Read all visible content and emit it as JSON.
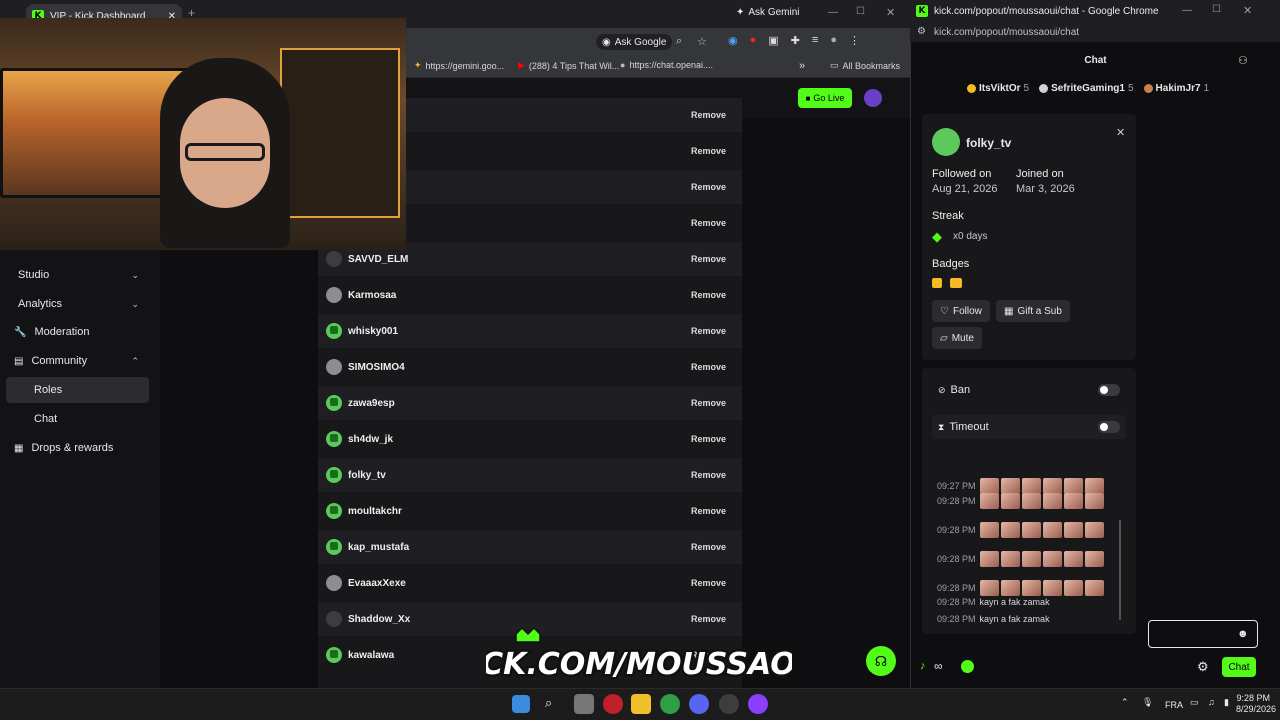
{
  "left_window": {
    "tab_title": "VIP - Kick Dashboard",
    "gemini_label": "Ask Gemini",
    "ask_google": "Ask Google",
    "bookmarks": [
      {
        "label": "https://gemini.goo..."
      },
      {
        "label": "(288) 4 Tips That Wil..."
      },
      {
        "label": "https://chat.openai...."
      }
    ],
    "all_bookmarks": "All Bookmarks"
  },
  "dashboard": {
    "go_live": "Go Live",
    "sidebar": [
      {
        "label": "Studio",
        "icon": "chevron-down-icon"
      },
      {
        "label": "Analytics",
        "icon": "chevron-down-icon"
      },
      {
        "label": "Moderation",
        "icon": "wrench-icon"
      },
      {
        "label": "Community",
        "icon": "chevron-up-icon"
      },
      {
        "label": "Roles",
        "active": true
      },
      {
        "label": "Chat"
      },
      {
        "label": "Drops & rewards",
        "icon": "gift-icon"
      }
    ],
    "remove_label": "Remove",
    "users": [
      {
        "name": "",
        "avatar": "none"
      },
      {
        "name": "",
        "avatar": "none"
      },
      {
        "name": "",
        "avatar": "none"
      },
      {
        "name": "",
        "avatar": "none"
      },
      {
        "name": "SAVVD_ELM",
        "avatar": "dark"
      },
      {
        "name": "Karmosaa",
        "avatar": "grey"
      },
      {
        "name": "whisky001",
        "avatar": "green"
      },
      {
        "name": "SIMOSIMO4",
        "avatar": "grey"
      },
      {
        "name": "zawa9esp",
        "avatar": "green"
      },
      {
        "name": "sh4dw_jk",
        "avatar": "green"
      },
      {
        "name": "folky_tv",
        "avatar": "green"
      },
      {
        "name": "moultakchr",
        "avatar": "green"
      },
      {
        "name": "kap_mustafa",
        "avatar": "green"
      },
      {
        "name": "EvaaaxXexe",
        "avatar": "grey"
      },
      {
        "name": "Shaddow_Xx",
        "avatar": "dark"
      },
      {
        "name": "kawalawa",
        "avatar": "green"
      }
    ]
  },
  "overlay": {
    "banner_text": "KICK.COM/MOUSSAOUI"
  },
  "right_window": {
    "title": "kick.com/popout/moussaoui/chat - Google Chrome",
    "address": "kick.com/popout/moussaoui/chat",
    "chat_heading": "Chat",
    "leaderboard": [
      {
        "name": "ItsViktOr",
        "count": "5",
        "color": "#f5b921"
      },
      {
        "name": "SefriteGaming1",
        "count": "5",
        "color": "#cfd3d6"
      },
      {
        "name": "HakimJr7",
        "count": "1",
        "color": "#c9814a"
      }
    ],
    "user_card": {
      "username": "folky_tv",
      "followed_label": "Followed on",
      "followed_date": "Aug 21, 2026",
      "joined_label": "Joined on",
      "joined_date": "Mar 3, 2026",
      "streak_label": "Streak",
      "streak_value": "x0 days",
      "badges_label": "Badges",
      "follow": "Follow",
      "gift_sub": "Gift a Sub",
      "mute": "Mute"
    },
    "mod": {
      "ban": "Ban",
      "timeout": "Timeout"
    },
    "messages": [
      {
        "time": "09:27 PM",
        "text": ""
      },
      {
        "time": "09:28 PM",
        "text": ""
      },
      {
        "time": "09:28 PM",
        "text": ""
      },
      {
        "time": "09:28 PM",
        "text": ""
      },
      {
        "time": "09:28 PM",
        "text": ""
      },
      {
        "time": "09:28 PM",
        "text": "kayn a fak zamak"
      },
      {
        "time": "09:28 PM",
        "text": "kayn a fak zamak"
      }
    ],
    "chat_button": "Chat"
  },
  "taskbar": {
    "lang": "FRA",
    "time": "9:28 PM",
    "date": "8/29/2026"
  }
}
